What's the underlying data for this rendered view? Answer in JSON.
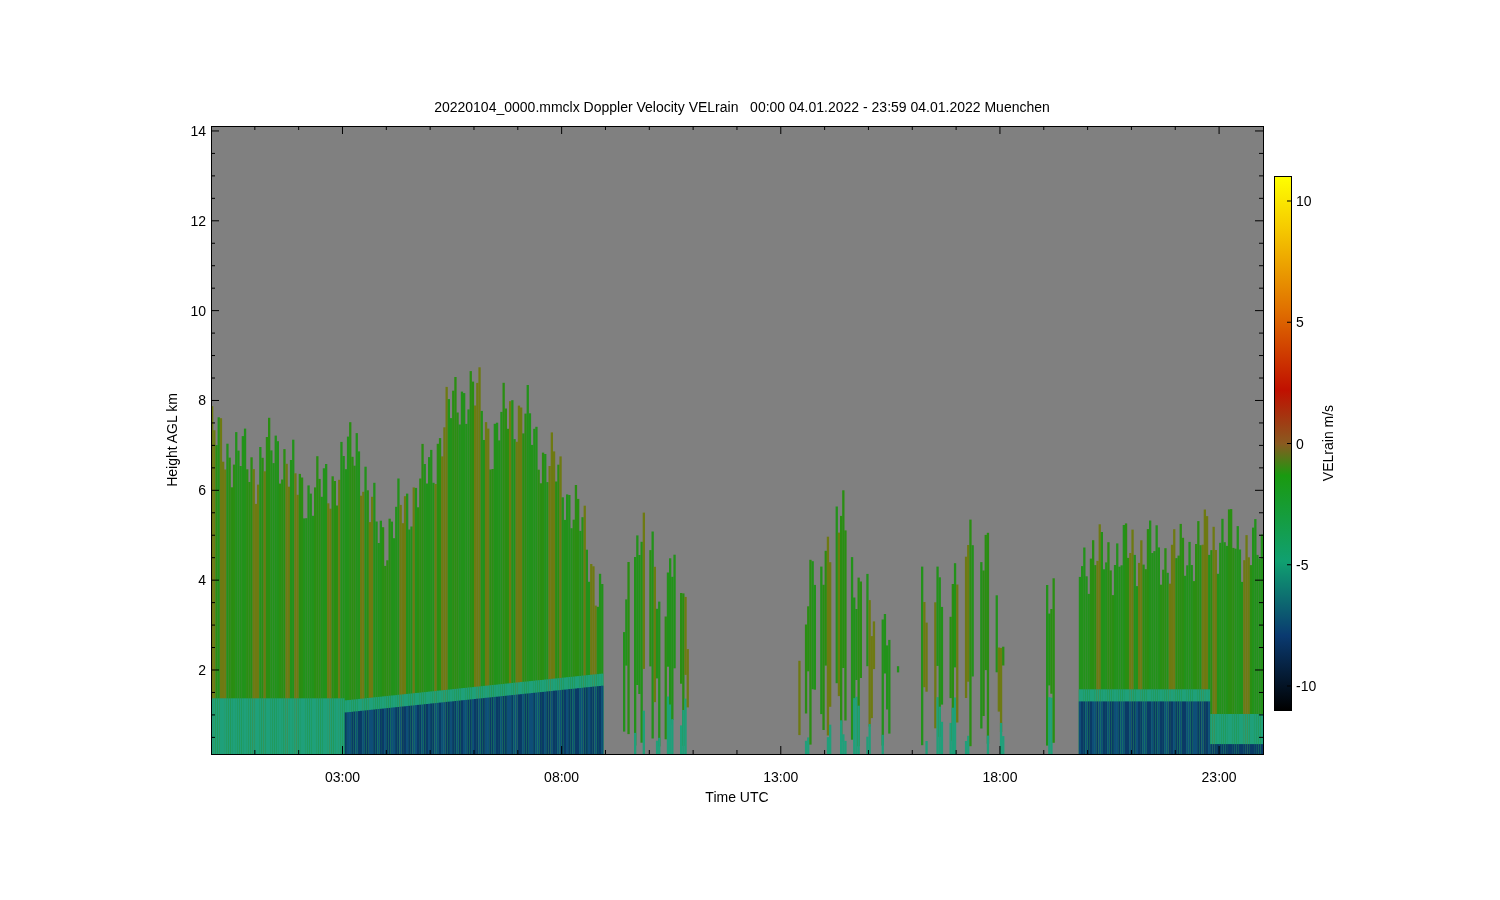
{
  "chart": {
    "title": "20220104_0000.mmclx Doppler Velocity VELrain   00:00 04.01.2022 - 23:59 04.01.2022 Muenchen",
    "xlabel": "Time UTC",
    "ylabel": "Height AGL km",
    "xticks": [
      "03:00",
      "08:00",
      "13:00",
      "18:00",
      "23:00"
    ],
    "yticks": [
      "14",
      "12",
      "10",
      "8",
      "6",
      "4",
      "2"
    ]
  },
  "colorbar": {
    "label": "VELrain m/s",
    "ticks": [
      "10",
      "5",
      "0",
      "-5",
      "-10"
    ]
  }
}
